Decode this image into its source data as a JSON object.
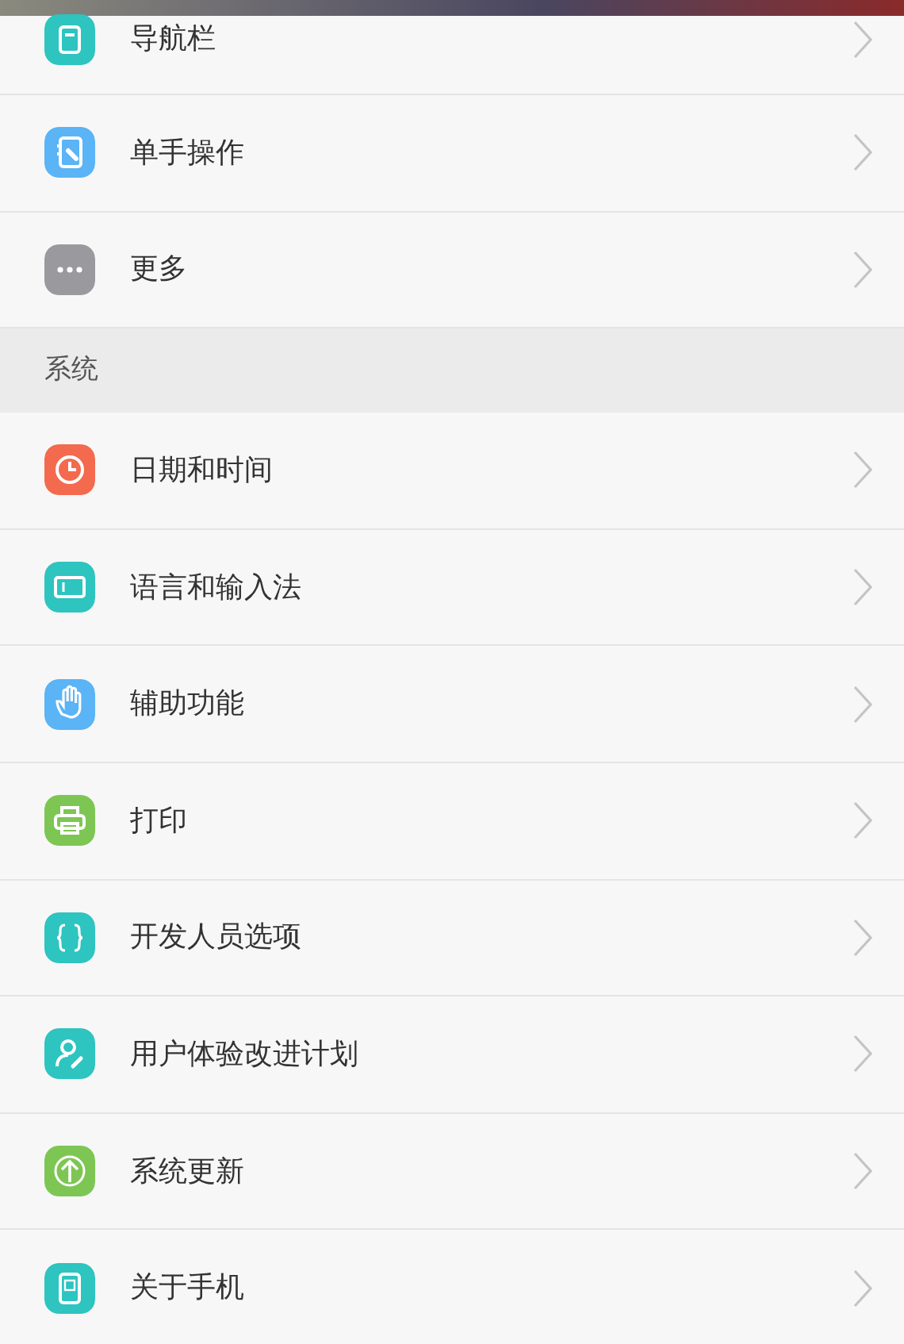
{
  "sections": [
    {
      "items": [
        {
          "label": "导航栏",
          "color": "#2ec4c0"
        },
        {
          "label": "单手操作",
          "color": "#5ab4f5"
        },
        {
          "label": "更多",
          "color": "#9a9a9e"
        }
      ]
    },
    {
      "header": "系统",
      "items": [
        {
          "label": "日期和时间",
          "color": "#f46a4e"
        },
        {
          "label": "语言和输入法",
          "color": "#2ec4c0"
        },
        {
          "label": "辅助功能",
          "color": "#5ab4f5"
        },
        {
          "label": "打印",
          "color": "#7dc653"
        },
        {
          "label": "开发人员选项",
          "color": "#2ec4c0"
        },
        {
          "label": "用户体验改进计划",
          "color": "#2ec4c0"
        },
        {
          "label": "系统更新",
          "color": "#7dc653"
        },
        {
          "label": "关于手机",
          "color": "#2ec4c0"
        }
      ]
    }
  ]
}
